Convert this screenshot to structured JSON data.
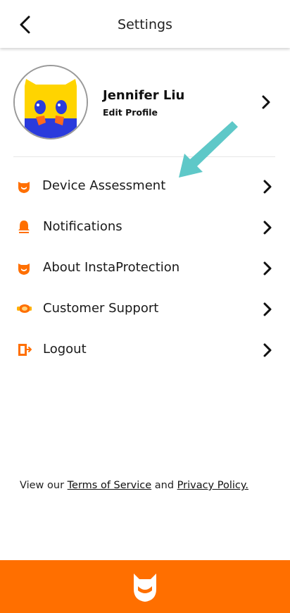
{
  "header": {
    "title": "Settings",
    "back_icon": "chevron-left-icon"
  },
  "profile": {
    "name": "Jennifer Liu",
    "edit_label": "Edit Profile",
    "avatar_colors": {
      "face": "#ffd400",
      "eyes": "#2a3bdc",
      "cheeks": "#ff6a1a",
      "base": "#2a3bdc"
    }
  },
  "menu": [
    {
      "label": "Device Assessment",
      "icon": "fox-shield-icon"
    },
    {
      "label": "Notifications",
      "icon": "bell-icon"
    },
    {
      "label": "About InstaProtection",
      "icon": "fox-shield-icon"
    },
    {
      "label": "Customer Support",
      "icon": "headset-icon"
    },
    {
      "label": "Logout",
      "icon": "logout-door-icon"
    }
  ],
  "footer": {
    "prefix": "View our ",
    "terms": "Terms of Service",
    "middle": " and ",
    "privacy": "Privacy Policy."
  },
  "colors": {
    "accent": "#ff6f00",
    "annotation_arrow": "#5ec8c8"
  }
}
